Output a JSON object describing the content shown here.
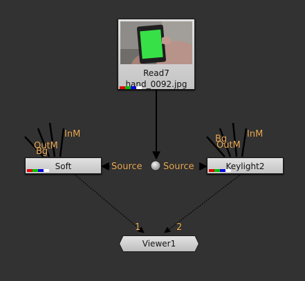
{
  "nodes": {
    "read": {
      "name": "Read7",
      "file": "hand_0092.jpg",
      "thumbnail": "hand-holding-green-screen-phone"
    },
    "soft": {
      "name": "Soft"
    },
    "keylight": {
      "name": "Keylight2"
    },
    "viewer": {
      "name": "Viewer1"
    }
  },
  "inputs": {
    "inm": "InM",
    "outm": "OutM",
    "bg": "Bg",
    "source": "Source",
    "viewer_in_1": "1",
    "viewer_in_2": "2"
  },
  "colors": {
    "background": "#323232",
    "wire": "#000000",
    "label": "#f2b05a",
    "node_fill": "#d0d0d0",
    "channel_red": "#e00000",
    "channel_green": "#00c000",
    "channel_blue": "#0000e0",
    "channel_alpha": "#ffffff"
  }
}
